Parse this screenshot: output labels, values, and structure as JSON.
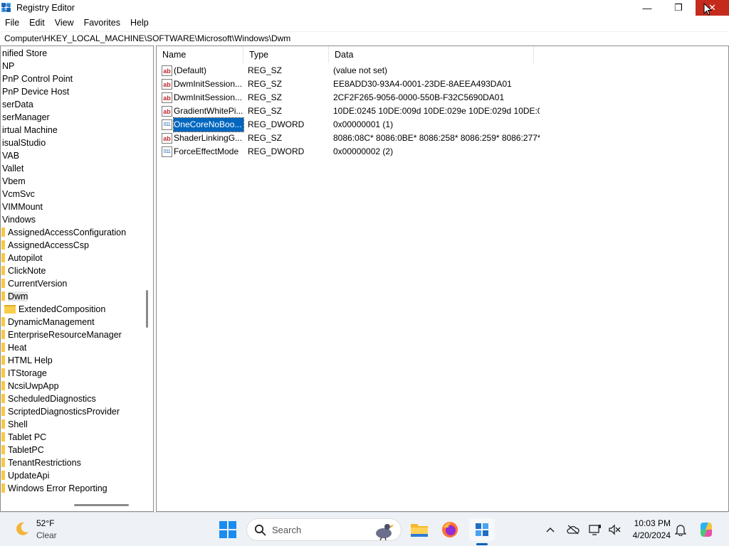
{
  "window": {
    "title": "Registry Editor",
    "min_glyph": "—",
    "max_glyph": "❐",
    "close_glyph": "✕"
  },
  "menu": [
    "File",
    "Edit",
    "View",
    "Favorites",
    "Help"
  ],
  "address": "Computer\\HKEY_LOCAL_MACHINE\\SOFTWARE\\Microsoft\\Windows\\Dwm",
  "tree": {
    "items": [
      {
        "label": "nified Store"
      },
      {
        "label": "NP"
      },
      {
        "label": "PnP Control Point"
      },
      {
        "label": "PnP Device Host"
      },
      {
        "label": "serData"
      },
      {
        "label": "serManager"
      },
      {
        "label": "irtual Machine"
      },
      {
        "label": "isualStudio"
      },
      {
        "label": "VAB"
      },
      {
        "label": "Vallet"
      },
      {
        "label": "Vbem"
      },
      {
        "label": "VcmSvc"
      },
      {
        "label": "VIMMount"
      },
      {
        "label": "Vindows"
      },
      {
        "label": "AssignedAccessConfiguration"
      },
      {
        "label": "AssignedAccessCsp"
      },
      {
        "label": "Autopilot"
      },
      {
        "label": "ClickNote"
      },
      {
        "label": "CurrentVersion"
      },
      {
        "label": "Dwm"
      },
      {
        "label": "ExtendedComposition"
      },
      {
        "label": "DynamicManagement"
      },
      {
        "label": "EnterpriseResourceManager"
      },
      {
        "label": "Heat"
      },
      {
        "label": "HTML Help"
      },
      {
        "label": "ITStorage"
      },
      {
        "label": "NcsiUwpApp"
      },
      {
        "label": "ScheduledDiagnostics"
      },
      {
        "label": "ScriptedDiagnosticsProvider"
      },
      {
        "label": "Shell"
      },
      {
        "label": "Tablet PC"
      },
      {
        "label": "TabletPC"
      },
      {
        "label": "TenantRestrictions"
      },
      {
        "label": "UpdateApi"
      },
      {
        "label": "Windows Error Reporting"
      }
    ],
    "selected": "Dwm"
  },
  "list": {
    "columns": {
      "name": "Name",
      "type": "Type",
      "data": "Data"
    },
    "rows": [
      {
        "name": "(Default)",
        "type": "REG_SZ",
        "data": "(value not set)",
        "icon": "ab"
      },
      {
        "name": "DwmInitSession...",
        "type": "REG_SZ",
        "data": "EE8ADD30-93A4-0001-23DE-8AEEA493DA01",
        "icon": "ab"
      },
      {
        "name": "DwmInitSession...",
        "type": "REG_SZ",
        "data": "2CF2F265-9056-0000-550B-F32C5690DA01",
        "icon": "ab"
      },
      {
        "name": "GradientWhitePi...",
        "type": "REG_SZ",
        "data": "10DE:0245 10DE:009d 10DE:029e 10DE:029d 10DE:02...",
        "icon": "ab"
      },
      {
        "name": "OneCoreNoBoo...",
        "type": "REG_DWORD",
        "data": "0x00000001 (1)",
        "icon": "011"
      },
      {
        "name": "ShaderLinkingG...",
        "type": "REG_SZ",
        "data": "8086:08C* 8086:0BE* 8086:258* 8086:259* 8086:277*...",
        "icon": "ab"
      },
      {
        "name": "ForceEffectMode",
        "type": "REG_DWORD",
        "data": "0x00000002 (2)",
        "icon": "011"
      }
    ],
    "selected_index": 4
  },
  "taskbar": {
    "weather_temp": "52°F",
    "weather_desc": "Clear",
    "search_placeholder": "Search",
    "clock_time": "10:03 PM",
    "clock_date": "4/20/2024"
  }
}
